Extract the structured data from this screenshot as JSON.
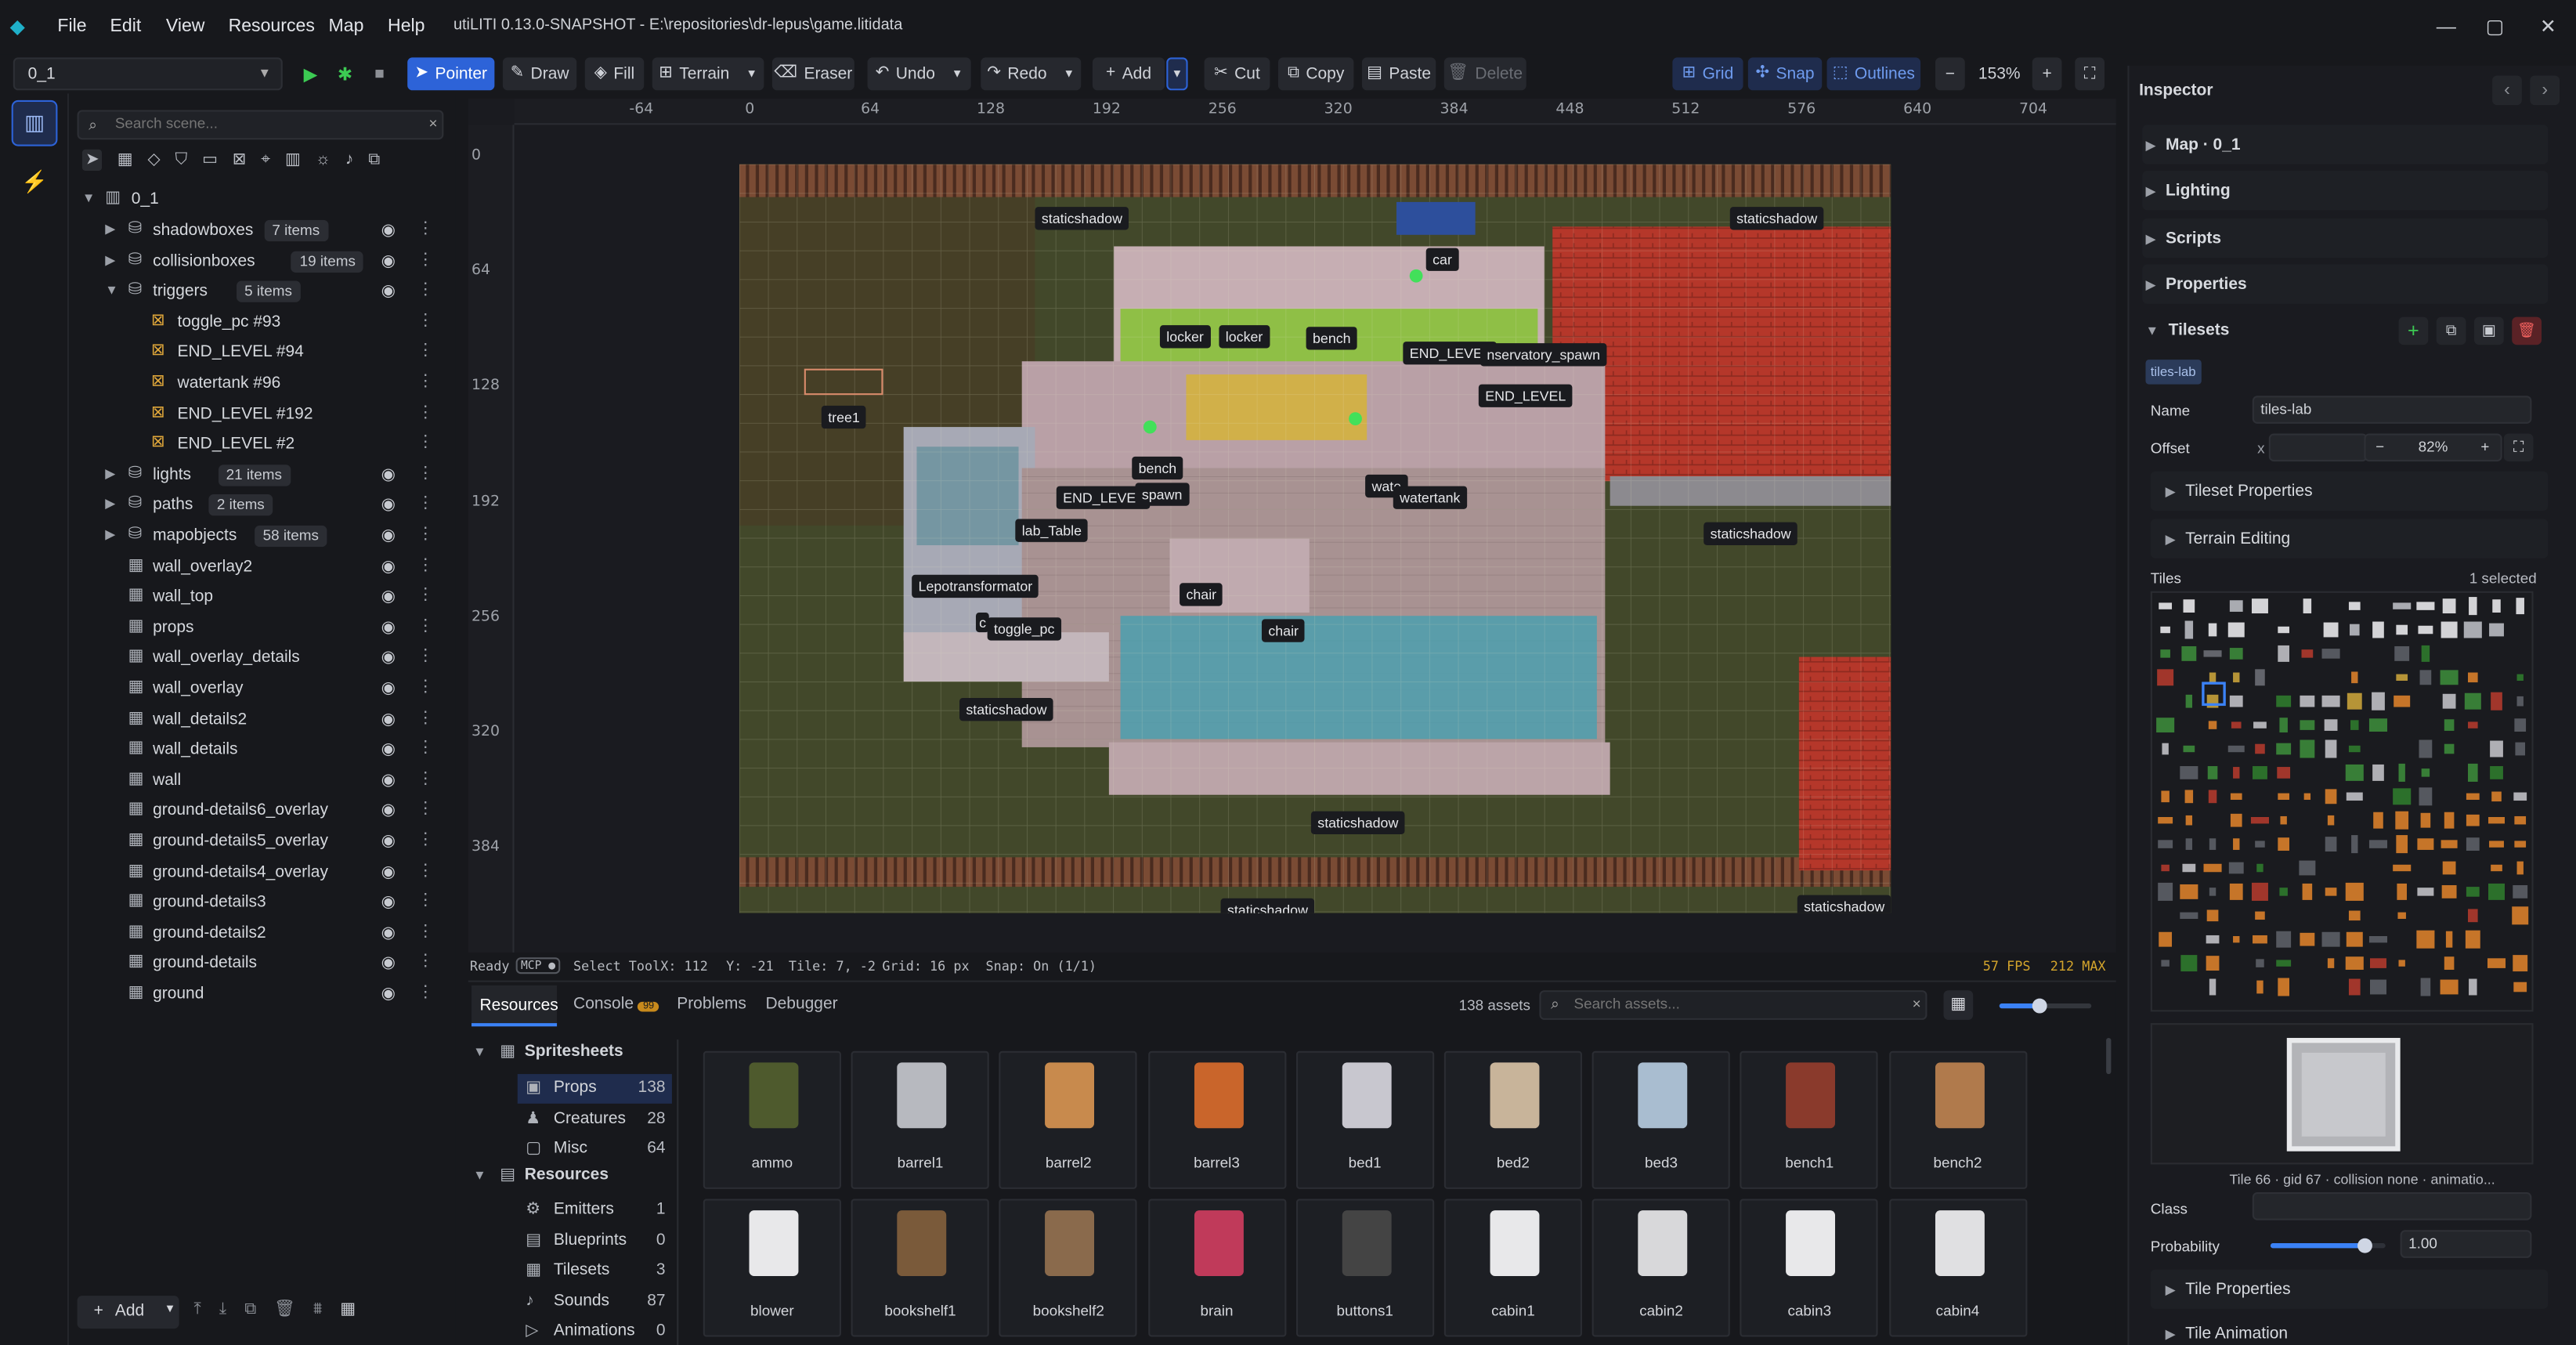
{
  "window": {
    "title": "utiLITI 0.13.0-SNAPSHOT - E:\\repositories\\dr-lepus\\game.litidata",
    "controls": [
      "—",
      "▢",
      "✕"
    ]
  },
  "menu": [
    "File",
    "Edit",
    "View",
    "Resources",
    "Map",
    "Help"
  ],
  "toolbar": {
    "map_select": "0_1",
    "pointer": "Pointer",
    "draw": "Draw",
    "fill": "Fill",
    "terrain": "Terrain",
    "eraser": "Eraser",
    "undo": "Undo",
    "redo": "Redo",
    "add": "Add",
    "cut": "Cut",
    "copy": "Copy",
    "paste": "Paste",
    "delete": "Delete",
    "grid": "Grid",
    "snap": "Snap",
    "outlines": "Outlines",
    "zoom": "153%"
  },
  "scene": {
    "search_placeholder": "Search scene...",
    "root": "0_1",
    "items": [
      {
        "label": "shadowboxes",
        "badge": "7 items",
        "level": 1,
        "group": true,
        "open": false
      },
      {
        "label": "collisionboxes",
        "badge": "19 items",
        "level": 1,
        "group": true,
        "open": false
      },
      {
        "label": "triggers",
        "badge": "5 items",
        "level": 1,
        "group": true,
        "open": true
      },
      {
        "label": "toggle_pc #93",
        "level": 2
      },
      {
        "label": "END_LEVEL #94",
        "level": 2
      },
      {
        "label": "watertank #96",
        "level": 2
      },
      {
        "label": "END_LEVEL #192",
        "level": 2
      },
      {
        "label": "END_LEVEL #2",
        "level": 2
      },
      {
        "label": "lights",
        "badge": "21 items",
        "level": 1,
        "group": true,
        "open": false
      },
      {
        "label": "paths",
        "badge": "2 items",
        "level": 1,
        "group": true,
        "open": false
      },
      {
        "label": "mapobjects",
        "badge": "58 items",
        "level": 1,
        "group": true,
        "open": false
      },
      {
        "label": "wall_overlay2",
        "level": 1
      },
      {
        "label": "wall_top",
        "level": 1
      },
      {
        "label": "props",
        "level": 1
      },
      {
        "label": "wall_overlay_details",
        "level": 1
      },
      {
        "label": "wall_overlay",
        "level": 1
      },
      {
        "label": "wall_details2",
        "level": 1
      },
      {
        "label": "wall_details",
        "level": 1
      },
      {
        "label": "wall",
        "level": 1
      },
      {
        "label": "ground-details6_overlay",
        "level": 1
      },
      {
        "label": "ground-details5_overlay",
        "level": 1
      },
      {
        "label": "ground-details4_overlay",
        "level": 1
      },
      {
        "label": "ground-details3",
        "level": 1
      },
      {
        "label": "ground-details2",
        "level": 1
      },
      {
        "label": "ground-details",
        "level": 1
      },
      {
        "label": "ground",
        "level": 1
      }
    ],
    "add_button": "Add"
  },
  "ruler": {
    "top": [
      "-64",
      "0",
      "64",
      "128",
      "192",
      "256",
      "320",
      "384",
      "448",
      "512",
      "576",
      "640",
      "704"
    ],
    "left": [
      "0",
      "64",
      "128",
      "192",
      "256",
      "320",
      "384"
    ]
  },
  "map_labels": [
    "staticshadow",
    "staticshadow",
    "car",
    "locker",
    "locker",
    "bench",
    "END_LEVEL",
    "nservatory_spawn",
    "END_LEVEL",
    "tree1",
    "bench",
    "END_LEVEL",
    "spawn",
    "wate",
    "watertank",
    "staticshadow",
    "lab_Table",
    "Lepotransformator",
    "chair",
    "chair",
    "toggle_pc",
    "staticshadow",
    "staticshadow",
    "staticshadow",
    "staticshadow",
    "c"
  ],
  "status": {
    "ready": "Ready",
    "mcp": "MCP ●",
    "tool": "Select Tool",
    "x": "X: 112",
    "y": "Y: -21",
    "tile": "Tile: 7, -2",
    "grid": "Grid: 16 px",
    "snap": "Snap: On (1/1)",
    "fps": "57 FPS",
    "max": "212 MAX"
  },
  "bottom": {
    "tabs": [
      "Resources",
      "Console",
      "Problems",
      "Debugger"
    ],
    "console_badge": "99",
    "asset_count": "138 assets",
    "search_placeholder": "Search assets...",
    "tree": {
      "spritesheets": "Spritesheets",
      "resources": "Resources",
      "sprites": [
        {
          "label": "Props",
          "count": "138"
        },
        {
          "label": "Creatures",
          "count": "28"
        },
        {
          "label": "Misc",
          "count": "64"
        }
      ],
      "res": [
        {
          "label": "Emitters",
          "count": "1"
        },
        {
          "label": "Blueprints",
          "count": "0"
        },
        {
          "label": "Tilesets",
          "count": "3"
        },
        {
          "label": "Sounds",
          "count": "87"
        },
        {
          "label": "Animations",
          "count": "0"
        }
      ]
    },
    "assets": [
      "ammo",
      "barrel1",
      "barrel2",
      "barrel3",
      "bed1",
      "bed2",
      "bed3",
      "bench1",
      "bench2",
      "blower",
      "bookshelf1",
      "bookshelf2",
      "brain",
      "buttons1",
      "cabin1",
      "cabin2",
      "cabin3",
      "cabin4"
    ]
  },
  "inspector": {
    "title": "Inspector",
    "sections": [
      "Map · 0_1",
      "Lighting",
      "Scripts",
      "Properties"
    ],
    "tilesets": "Tilesets",
    "tileset_tab": "tiles-lab",
    "name_label": "Name",
    "name_value": "tiles-lab",
    "offset_label": "Offset",
    "offset_x": "x",
    "offset_zoom": "82%",
    "tileset_properties": "Tileset Properties",
    "terrain_editing": "Terrain Editing",
    "tiles_label": "Tiles",
    "selected": "1 selected",
    "tile_info": "Tile 66 · gid 67 · collision none · animatio...",
    "class_label": "Class",
    "probability_label": "Probability",
    "probability_value": "1.00",
    "probability": 0.82,
    "tile_properties": "Tile Properties",
    "tile_animation": "Tile Animation"
  }
}
